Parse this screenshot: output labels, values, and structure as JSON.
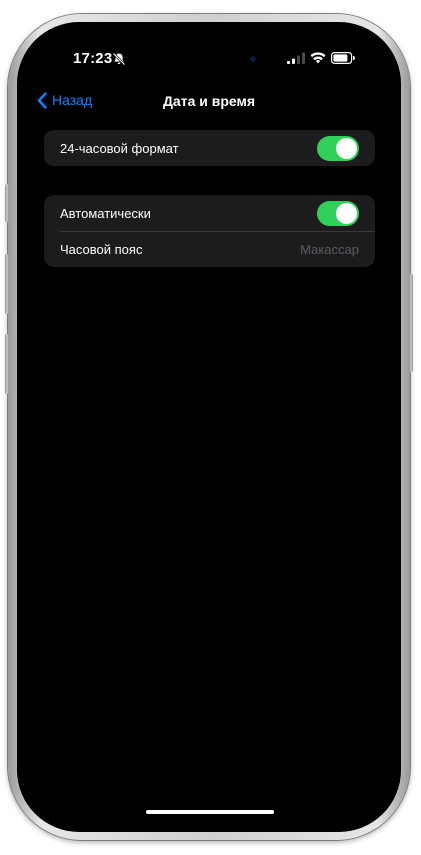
{
  "status_bar": {
    "time": "17:23",
    "bell_icon": "bell-slash-icon",
    "signal_icon": "cellular-signal-icon",
    "wifi_icon": "wifi-icon",
    "battery_icon": "battery-icon"
  },
  "nav": {
    "back_label": "Назад",
    "back_icon": "chevron-left-icon",
    "title": "Дата и время"
  },
  "groups": [
    {
      "rows": [
        {
          "label": "24-часовой формат",
          "toggle_on": true
        }
      ]
    },
    {
      "rows": [
        {
          "label": "Автоматически",
          "toggle_on": true
        },
        {
          "label": "Часовой пояс",
          "value": "Макассар"
        }
      ]
    }
  ],
  "colors": {
    "accent": "#0a84ff",
    "toggle_on": "#30d158",
    "cell_background": "#1c1c1e",
    "screen_background": "#000000",
    "secondary_text": "#5c5c60"
  }
}
